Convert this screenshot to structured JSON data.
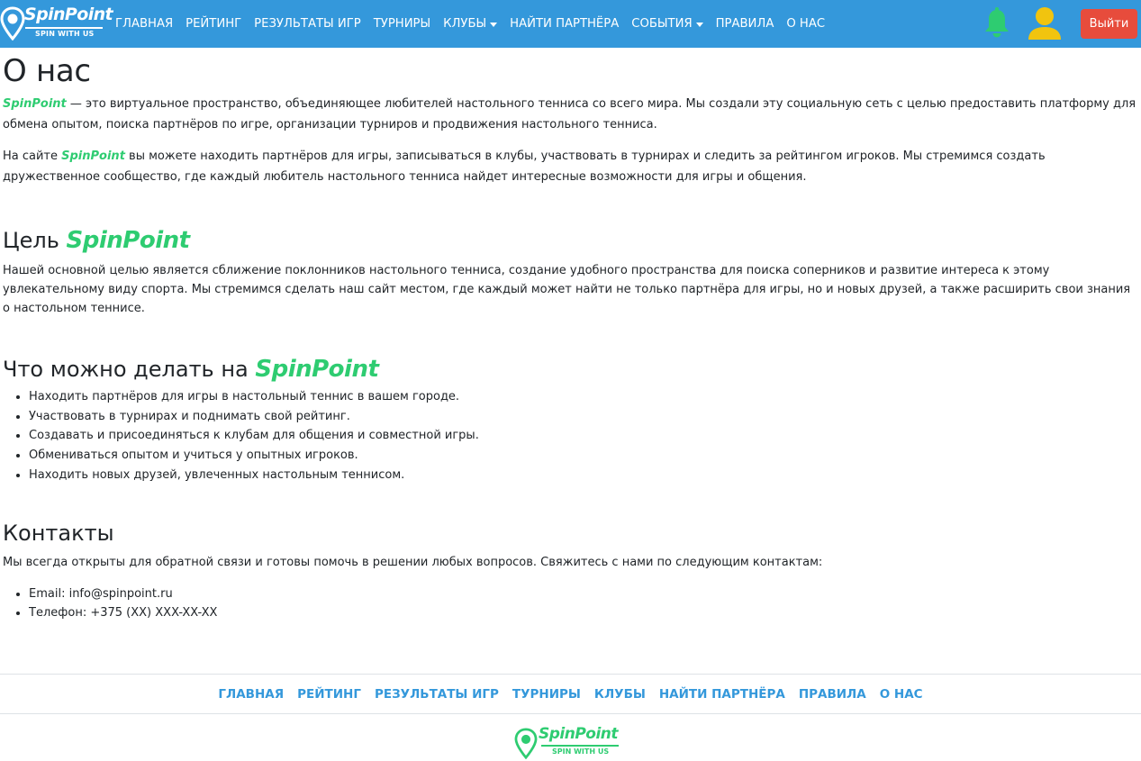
{
  "brand": {
    "name": "SpinPoint",
    "tagline": "SPIN WITH US"
  },
  "nav": {
    "items": [
      {
        "label": "ГЛАВНАЯ",
        "dropdown": false
      },
      {
        "label": "РЕЙТИНГ",
        "dropdown": false
      },
      {
        "label": "РЕЗУЛЬТАТЫ ИГР",
        "dropdown": false
      },
      {
        "label": "ТУРНИРЫ",
        "dropdown": false
      },
      {
        "label": "КЛУБЫ",
        "dropdown": true
      },
      {
        "label": "НАЙТИ ПАРТНЁРА",
        "dropdown": false
      },
      {
        "label": "СОБЫТИЯ",
        "dropdown": true
      },
      {
        "label": "ПРАВИЛА",
        "dropdown": false
      },
      {
        "label": "О НАС",
        "dropdown": false
      }
    ],
    "notification_icon": "bell-icon",
    "profile_icon": "user-icon",
    "logout_label": "Выйти"
  },
  "colors": {
    "navbar": "#3498db",
    "brand_green": "#2ecc71",
    "logout": "#e74c3c",
    "bell": "#2ecc71",
    "user": "#f1c40f"
  },
  "page": {
    "title": "О нас",
    "intro": {
      "brand": "SpinPoint",
      "text": " — это виртуальное пространство, объединяющее любителей настольного тенниса со всего мира. Мы создали эту социальную сеть с целью предоставить платформу для обмена опытом, поиска партнёров по игре, организации турниров и продвижения настольного тенниса."
    },
    "intro2": {
      "before": "На сайте ",
      "brand": "SpinPoint",
      "after": " вы можете находить партнёров для игры, записываться в клубы, участвовать в турнирах и следить за рейтингом игроков. Мы стремимся создать дружественное сообщество, где каждый любитель настольного тенниса найдет интересные возможности для игры и общения."
    },
    "goal": {
      "heading": "Цель ",
      "brand": "SpinPoint",
      "text": "Нашей основной целью является сближение поклонников настольного тенниса, создание удобного пространства для поиска соперников и развитие интереса к этому увлекательному виду спорта. Мы стремимся сделать наш сайт местом, где каждый может найти не только партнёра для игры, но и новых друзей, а также расширить свои знания о настольном теннисе."
    },
    "features": {
      "heading": "Что можно делать на ",
      "brand": "SpinPoint",
      "items": [
        "Находить партнёров для игры в настольный теннис в вашем городе.",
        "Участвовать в турнирах и поднимать свой рейтинг.",
        "Создавать и присоединяться к клубам для общения и совместной игры.",
        "Обмениваться опытом и учиться у опытных игроков.",
        "Находить новых друзей, увлеченных настольным теннисом."
      ]
    },
    "contacts": {
      "heading": "Контакты",
      "text": "Мы всегда открыты для обратной связи и готовы помочь в решении любых вопросов. Свяжитесь с нами по следующим контактам:",
      "items": [
        "Email: info@spinpoint.ru",
        "Телефон: +375 (XX) XXX-XX-XX"
      ]
    }
  },
  "footer": {
    "links": [
      "ГЛАВНАЯ",
      "РЕЙТИНГ",
      "РЕЗУЛЬТАТЫ ИГР",
      "ТУРНИРЫ",
      "КЛУБЫ",
      "НАЙТИ ПАРТНЁРА",
      "ПРАВИЛА",
      "О НАС"
    ],
    "brand": "SpinPoint",
    "tagline": "SPIN WITH US"
  }
}
